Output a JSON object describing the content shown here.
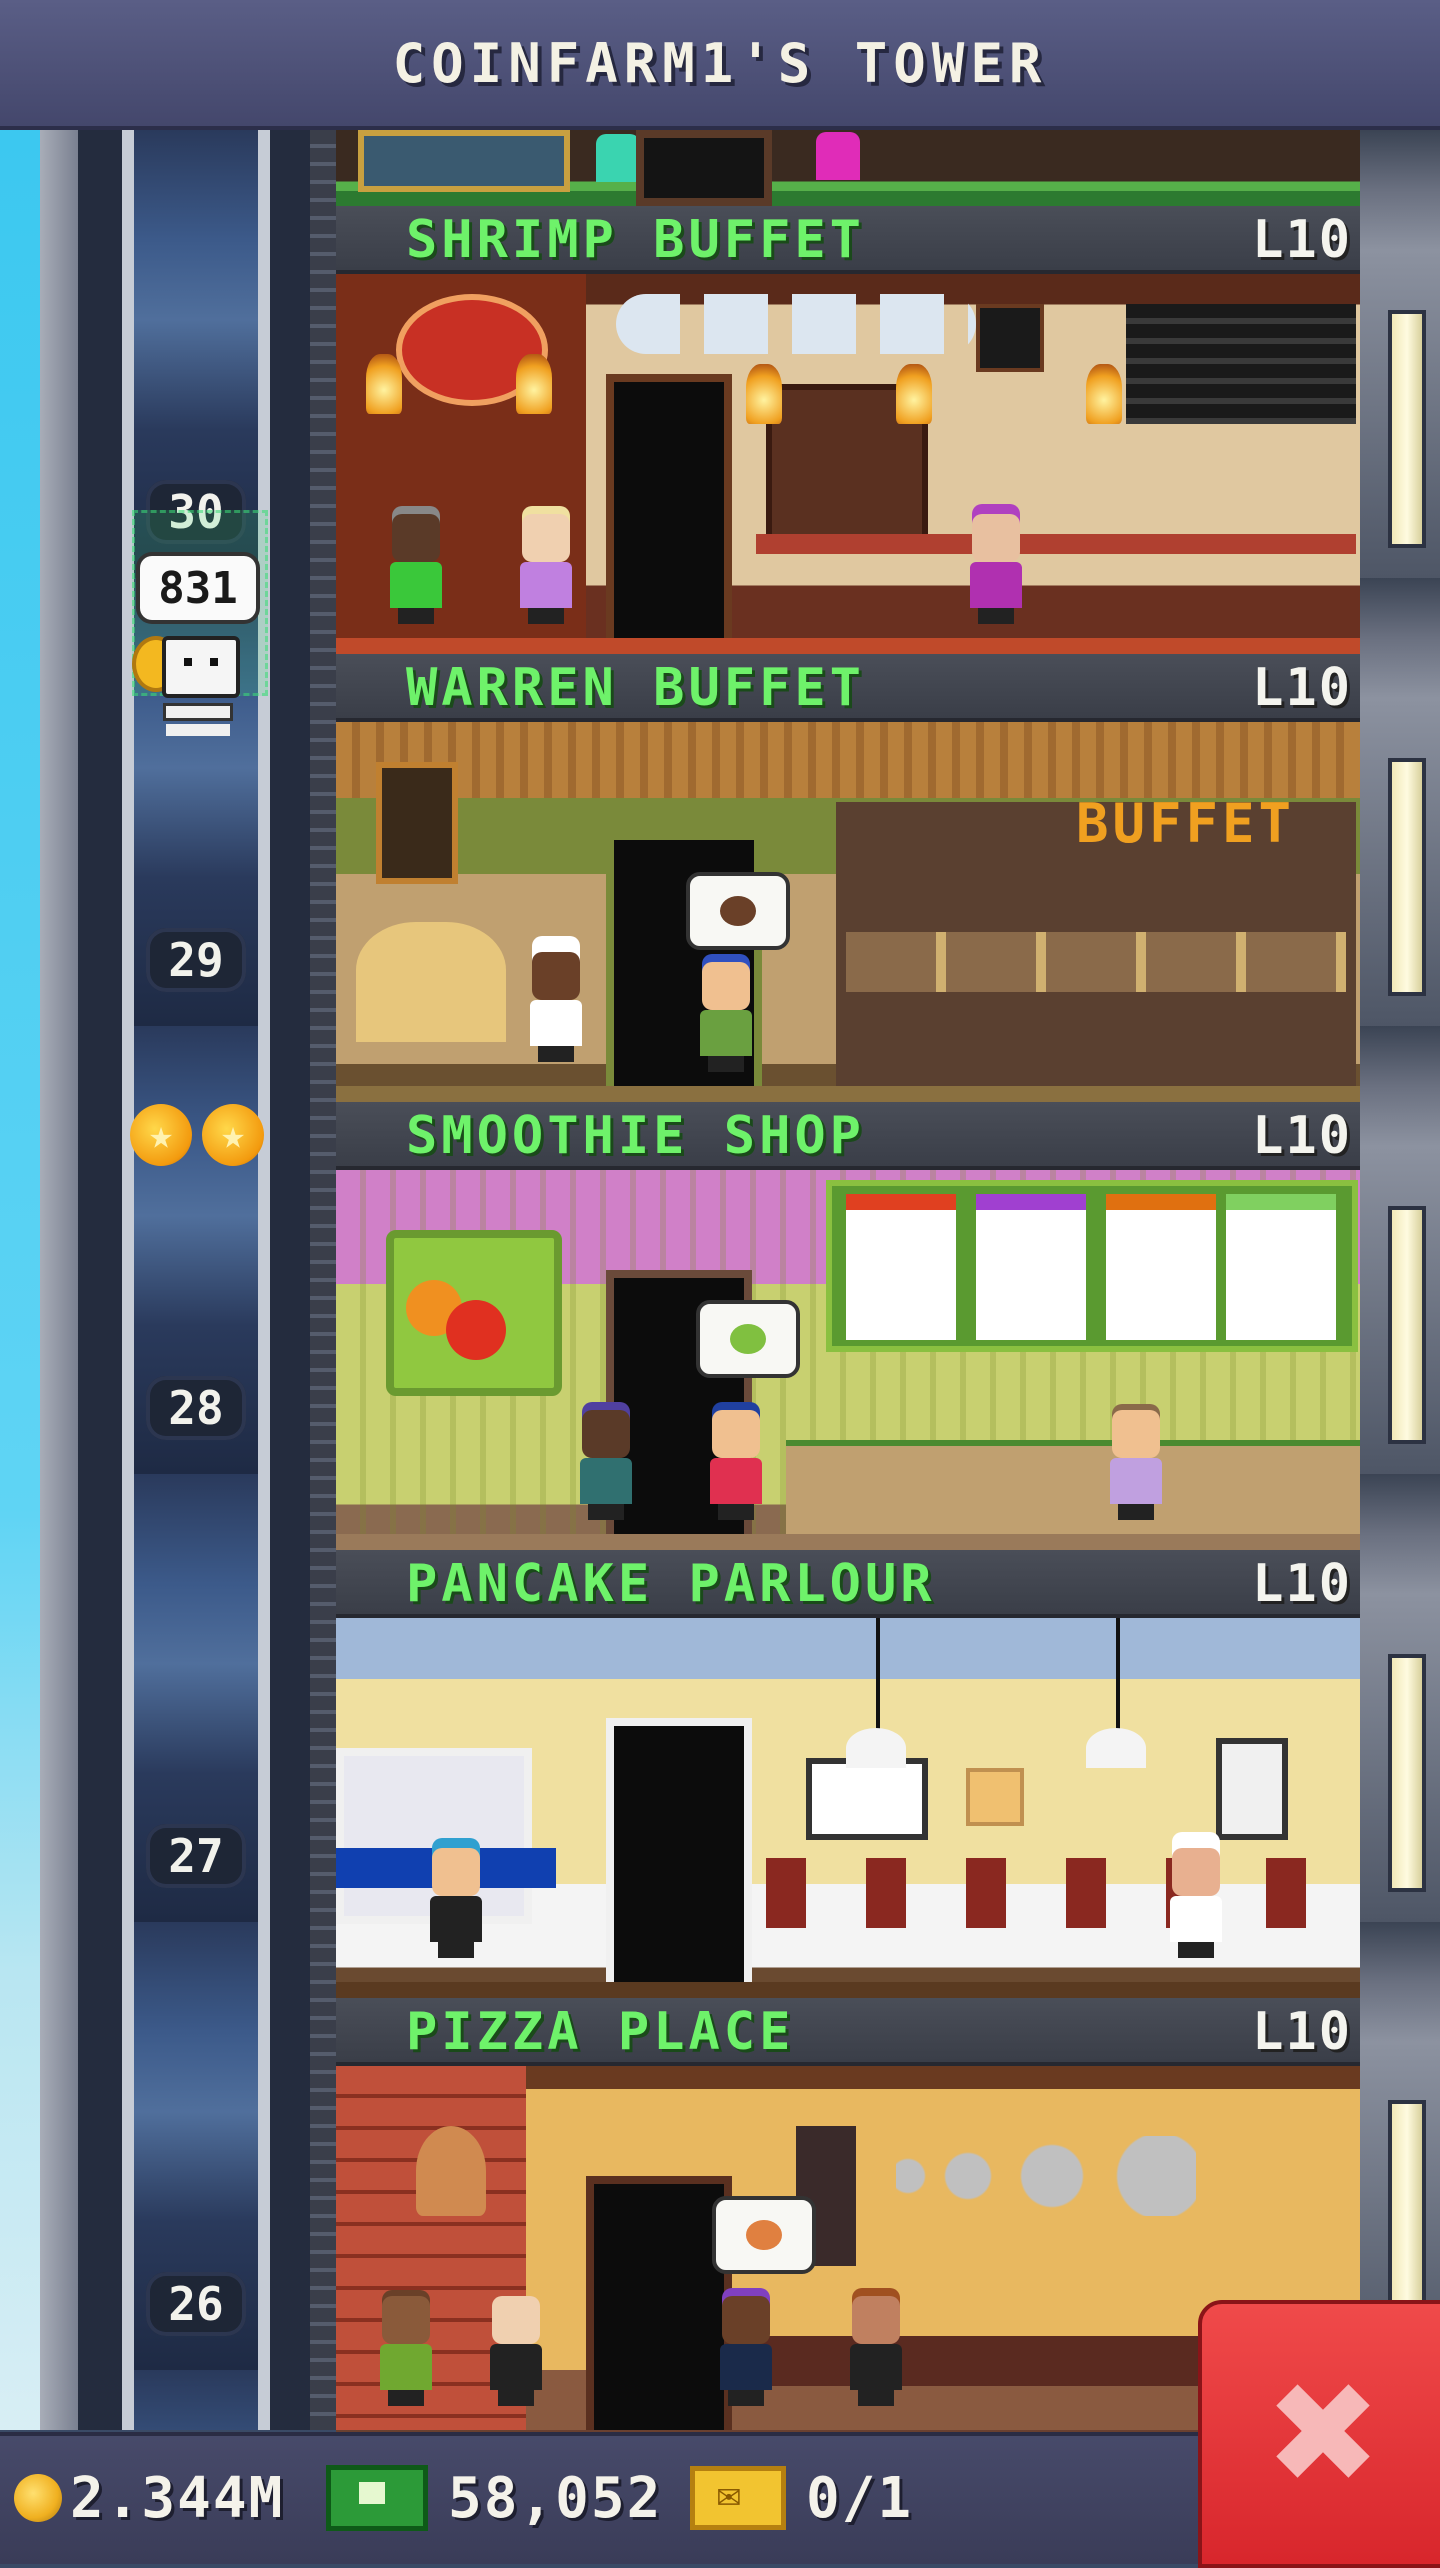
{
  "header": {
    "title": "COINFARM1'S TOWER"
  },
  "elevator": {
    "floor_labels": [
      "30",
      "29",
      "28",
      "27",
      "26"
    ],
    "passenger_bubble": "831"
  },
  "floors": [
    {
      "name": "SHRIMP BUFFET",
      "level": "L10"
    },
    {
      "name": "WARREN BUFFET",
      "level": "L10",
      "sign": "BUFFET"
    },
    {
      "name": "SMOOTHIE SHOP",
      "level": "L10"
    },
    {
      "name": "PANCAKE PARLOUR",
      "level": "L10"
    },
    {
      "name": "PIZZA PLACE",
      "level": "L10"
    }
  ],
  "footer": {
    "coins": "2.344M",
    "bux": "58,052",
    "tickets": "0/1"
  },
  "colors": {
    "floor_name": "#6ef26a",
    "close_button": "#e2343a",
    "title_bar": "#4d5078"
  },
  "icons": {
    "coin": "coin-icon",
    "bux": "bux-icon",
    "ticket": "ticket-icon",
    "close": "close-icon",
    "star": "star-icon"
  }
}
